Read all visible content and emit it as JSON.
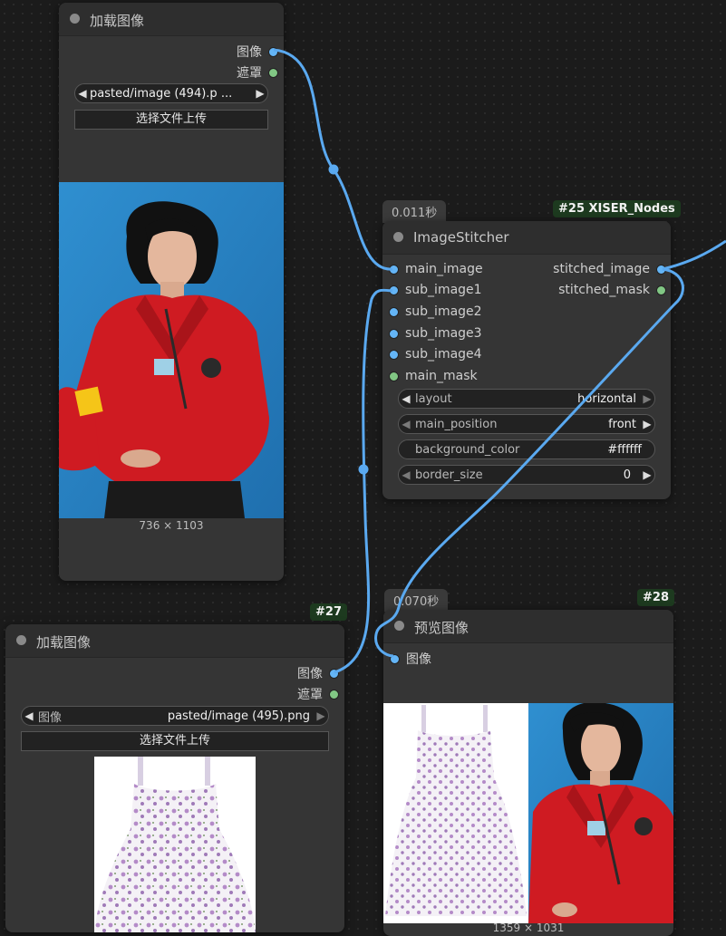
{
  "node_load1": {
    "title": "加载图像",
    "outputs": [
      "图像",
      "遮罩"
    ],
    "file_value": "pasted/image (494).p ...",
    "upload_label": "选择文件上传",
    "dimensions": "736 × 1103"
  },
  "node_stitcher": {
    "timing": "0.011秒",
    "badge": "#25 XISER_Nodes",
    "title": "ImageStitcher",
    "inputs": [
      "main_image",
      "sub_image1",
      "sub_image2",
      "sub_image3",
      "sub_image4",
      "main_mask"
    ],
    "outputs": [
      "stitched_image",
      "stitched_mask"
    ],
    "widgets": [
      {
        "label": "layout",
        "value": "horizontal"
      },
      {
        "label": "main_position",
        "value": "front"
      },
      {
        "label": "background_color",
        "value": "#ffffff"
      },
      {
        "label": "border_size",
        "value": "0"
      }
    ]
  },
  "node_load2": {
    "badge": "#27",
    "title": "加载图像",
    "outputs": [
      "图像",
      "遮罩"
    ],
    "file_label": "图像",
    "file_value": "pasted/image (495).png",
    "upload_label": "选择文件上传"
  },
  "node_preview": {
    "timing": "0.070秒",
    "badge": "#28",
    "title": "预览图像",
    "inputs": [
      "图像"
    ],
    "dimensions": "1359 × 1031"
  },
  "colors": {
    "image_slot": "#64b5f6",
    "mask_slot": "#81c784",
    "wire": "#5aa9f0",
    "badge_bg": "#1d3a1f",
    "photo_bg": "#2b86c8",
    "jacket": "#cf1b22"
  }
}
